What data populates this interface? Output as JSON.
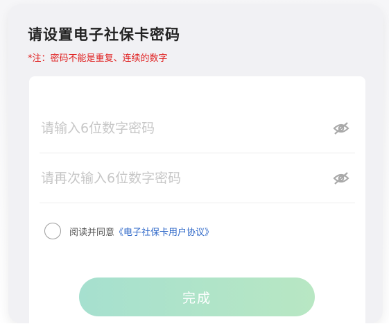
{
  "header": {
    "title": "请设置电子社保卡密码",
    "note": "*注：密码不能是重复、连续的数字"
  },
  "form": {
    "password_placeholder": "请输入6位数字密码",
    "password": "",
    "confirm_placeholder": "请再次输入6位数字密码",
    "confirm": "",
    "eye_icon": "eye-off-icon"
  },
  "agreement": {
    "checked": false,
    "text": "阅读并同意",
    "link": "《电子社保卡用户协议》"
  },
  "submit": {
    "label": "完成",
    "enabled": false
  },
  "colors": {
    "note": "#e02020",
    "link": "#2f68c8",
    "button_start": "#a6e0cf",
    "button_end": "#b8e7c3"
  }
}
